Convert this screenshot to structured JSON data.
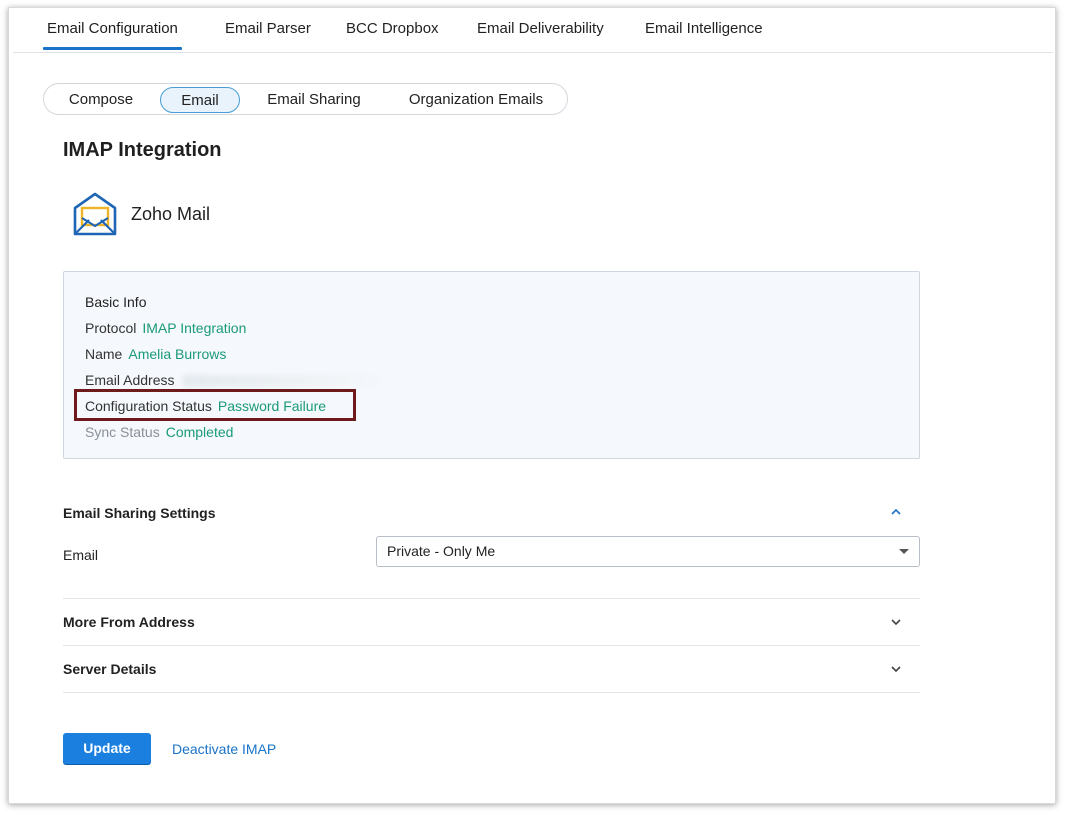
{
  "top_tabs": [
    "Email Configuration",
    "Email Parser",
    "BCC Dropbox",
    "Email Deliverability",
    "Email Intelligence"
  ],
  "sub_tabs": [
    "Compose",
    "Email",
    "Email Sharing",
    "Organization Emails"
  ],
  "heading": "IMAP Integration",
  "provider": {
    "name": "Zoho Mail",
    "icon": "zoho-mail-icon"
  },
  "basic_info": {
    "title": "Basic Info",
    "protocol_label": "Protocol",
    "protocol_value": "IMAP Integration",
    "name_label": "Name",
    "name_value": "Amelia Burrows",
    "email_label": "Email Address",
    "config_status_label": "Configuration Status",
    "config_status_value": "Password Failure",
    "sync_status_label": "Sync Status",
    "sync_status_value": "Completed"
  },
  "sharing": {
    "title": "Email Sharing Settings",
    "email_label": "Email",
    "email_value": "Private - Only Me"
  },
  "sections": {
    "more_from": "More From Address",
    "server_details": "Server Details"
  },
  "actions": {
    "update": "Update",
    "deactivate": "Deactivate IMAP"
  },
  "colors": {
    "accent": "#1a73c8",
    "status_value": "#1a9a7a",
    "highlight": "#6f1a1a",
    "primary_button": "#1b7fe0"
  }
}
